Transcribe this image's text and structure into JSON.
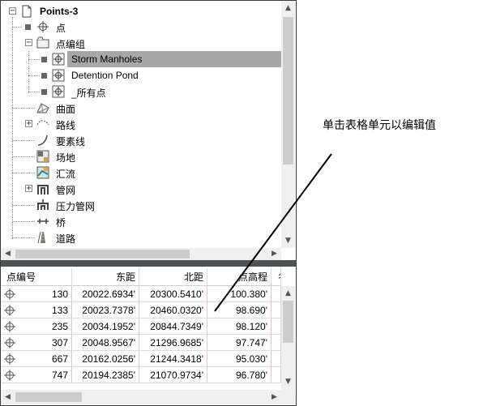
{
  "tree": {
    "root_label": "Points-3",
    "items": [
      {
        "label": "点",
        "icon": "point-icon"
      },
      {
        "label": "点编组",
        "icon": "point-group-icon"
      },
      {
        "label": "Storm Manholes",
        "icon": "point-group-item-icon"
      },
      {
        "label": "Detention Pond",
        "icon": "point-group-item-icon"
      },
      {
        "label": "_所有点",
        "icon": "point-group-item-icon"
      },
      {
        "label": "曲面",
        "icon": "surface-icon"
      },
      {
        "label": "路线",
        "icon": "alignment-icon"
      },
      {
        "label": "要素线",
        "icon": "feature-line-icon"
      },
      {
        "label": "场地",
        "icon": "site-icon"
      },
      {
        "label": "汇流",
        "icon": "catchment-icon"
      },
      {
        "label": "管网",
        "icon": "pipe-network-icon"
      },
      {
        "label": "压力管网",
        "icon": "pressure-network-icon"
      },
      {
        "label": "桥",
        "icon": "bridge-icon"
      },
      {
        "label": "道路",
        "icon": "corridor-icon"
      }
    ]
  },
  "table": {
    "columns": [
      "点编号",
      "东距",
      "北距",
      "点高程",
      "名"
    ],
    "rows": [
      {
        "number": "130",
        "easting": "20022.6934'",
        "northing": "20300.5410'",
        "elevation": "100.380'"
      },
      {
        "number": "133",
        "easting": "20023.7378'",
        "northing": "20460.0320'",
        "elevation": "98.690'"
      },
      {
        "number": "235",
        "easting": "20034.1952'",
        "northing": "20844.7349'",
        "elevation": "98.120'"
      },
      {
        "number": "307",
        "easting": "20048.9567'",
        "northing": "21296.9685'",
        "elevation": "97.747'"
      },
      {
        "number": "667",
        "easting": "20162.0256'",
        "northing": "21244.3418'",
        "elevation": "95.030'"
      },
      {
        "number": "747",
        "easting": "20194.2385'",
        "northing": "21070.9734'",
        "elevation": "96.780'"
      }
    ]
  },
  "annotation": {
    "text": "单击表格单元以编辑值"
  },
  "colors": {
    "selection": "#a7a7a7",
    "splitter": "#4d5159",
    "scroll_thumb": "#cdcdcd"
  }
}
